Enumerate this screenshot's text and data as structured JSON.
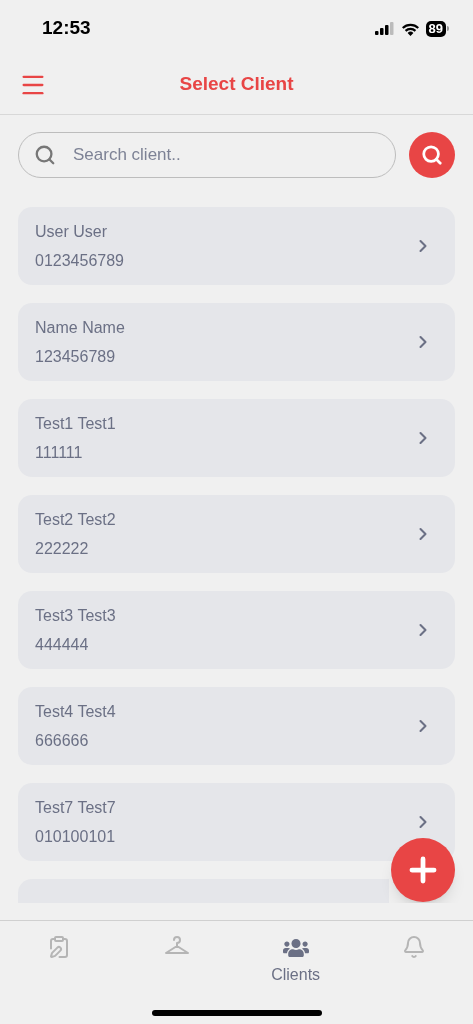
{
  "status_bar": {
    "time": "12:53",
    "battery": "89"
  },
  "header": {
    "title": "Select Client"
  },
  "search": {
    "placeholder": "Search client.."
  },
  "clients": [
    {
      "kind": "client",
      "name": "User User",
      "phone": "0123456789"
    },
    {
      "kind": "client",
      "name": "Name Name",
      "phone": "123456789"
    },
    {
      "kind": "client",
      "name": "Test1 Test1",
      "phone": "111111"
    },
    {
      "kind": "client",
      "name": "Test2 Test2",
      "phone": "222222"
    },
    {
      "kind": "client",
      "name": "Test3 Test3",
      "phone": "444444"
    },
    {
      "kind": "client",
      "name": "Test4 Test4",
      "phone": "666666"
    },
    {
      "kind": "client",
      "name": "Test7 Test7",
      "phone": "010100101"
    },
    {
      "kind": "cut"
    }
  ],
  "nav": [
    {
      "kind": "tasks",
      "selected": false
    },
    {
      "kind": "hanger",
      "selected": false
    },
    {
      "kind": "clients",
      "selected": true,
      "label": "Clients"
    },
    {
      "kind": "notifications",
      "selected": false
    }
  ]
}
